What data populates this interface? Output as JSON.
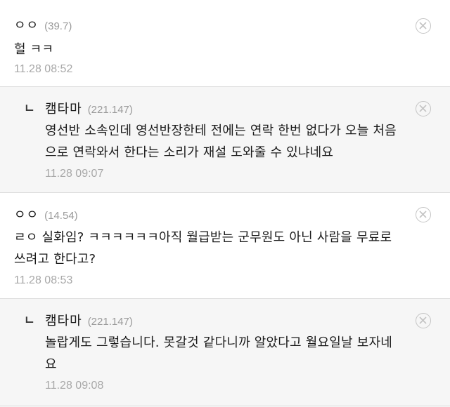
{
  "comments": [
    {
      "nickname": "ㅇㅇ",
      "ip": "(39.7)",
      "text_lines": [
        "헐 ㅋㅋ"
      ],
      "timestamp": "11.28 08:52"
    },
    {
      "reply_mark": "ㄴ",
      "nickname": "캠타마",
      "ip": "(221.147)",
      "text_lines": [
        "영선반 소속인데 영선반장한테 전에는 연락 한번 없다가 오늘 처음",
        "으로 연락와서 한다는 소리가 재설 도와줄 수 있냐네요"
      ],
      "timestamp": "11.28 09:07"
    },
    {
      "nickname": "ㅇㅇ",
      "ip": "(14.54)",
      "text_lines": [
        "ㄹㅇ 실화임? ㅋㅋㅋㅋㅋㅋ아직 월급받는 군무원도 아닌 사람을 무료로",
        "쓰려고 한다고?"
      ],
      "timestamp": "11.28 08:53"
    },
    {
      "reply_mark": "ㄴ",
      "nickname": "캠타마",
      "ip": "(221.147)",
      "text_lines": [
        "놀랍게도 그렇습니다. 못갈것 같다니까 알았다고 월요일날 보자네",
        "요"
      ],
      "timestamp": "11.28 09:08"
    }
  ],
  "icons": {
    "delete": "close-circle-icon"
  },
  "colors": {
    "reply_background": "#f6f6f6",
    "meta_gray": "#a8a8a8",
    "divider": "#dddddd"
  }
}
